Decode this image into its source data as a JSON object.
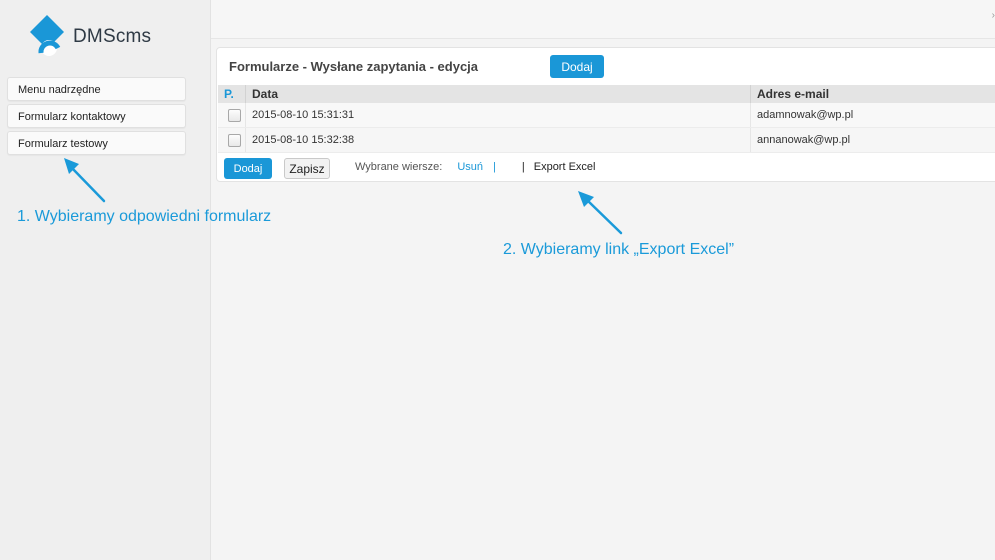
{
  "brand": {
    "name": "DMScms",
    "colors": {
      "primary": "#1a97d7",
      "text": "#2f3a45"
    }
  },
  "sidebar": {
    "items": [
      {
        "label": "Menu nadrzędne"
      },
      {
        "label": "Formularz kontaktowy"
      },
      {
        "label": "Formularz testowy"
      }
    ]
  },
  "panel": {
    "title": "Formularze - Wysłane zapytania - edycja",
    "add_label": "Dodaj",
    "table": {
      "columns": [
        "P.",
        "Data",
        "Adres e-mail"
      ],
      "rows": [
        {
          "date": "2015-08-10 15:31:31",
          "email": "adamnowak@wp.pl"
        },
        {
          "date": "2015-08-10 15:32:38",
          "email": "annanowak@wp.pl"
        }
      ]
    },
    "footer": {
      "add_label": "Dodaj",
      "save_label": "Zapisz",
      "selected_label": "Wybrane wiersze:",
      "delete_label": "Usuń",
      "sep_first": "|",
      "sep_second": "|",
      "export_label": "Export Excel"
    }
  },
  "annotations": {
    "step1": "1. Wybieramy odpowiedni formularz",
    "step2": "2. Wybieramy link „Export Excel”"
  }
}
